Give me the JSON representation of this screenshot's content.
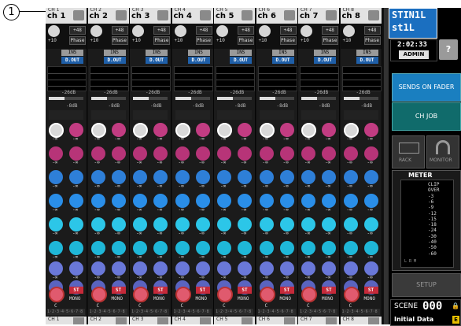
{
  "callout": {
    "label": "1"
  },
  "channels": [
    {
      "num": "CH 1",
      "name": "ch 1"
    },
    {
      "num": "CH 2",
      "name": "ch 2"
    },
    {
      "num": "CH 3",
      "name": "ch 3"
    },
    {
      "num": "CH 4",
      "name": "ch 4"
    },
    {
      "num": "CH 5",
      "name": "ch 5"
    },
    {
      "num": "CH 6",
      "name": "ch 6"
    },
    {
      "num": "CH 7",
      "name": "ch 7"
    },
    {
      "num": "CH 8",
      "name": "ch 8"
    }
  ],
  "strip": {
    "gain": "+10",
    "phantom": "+48",
    "phase": "Phase",
    "ins": "INS",
    "dout": "D.OUT",
    "thr1": "-26dB",
    "thr2": "-8dB",
    "send_value": "-∞",
    "pan_center": "C",
    "st": "ST",
    "mono": "MONO",
    "bus": "1·2·3·4·5·6·7·8"
  },
  "colors": {
    "send_row_1": "#c23c82",
    "send_row_2": "#b73478",
    "send_row_3": "#2e7fd8",
    "send_row_4": "#2a8ee8",
    "send_row_5": "#2cc6e8",
    "send_row_6": "#1fb7d8",
    "send_row_7": "#6a78d8",
    "send_row_8": "#5a64c0",
    "first_knob_big": "#d8d8d8"
  },
  "selected_channel": {
    "line1": "STIN1L",
    "line2": "st1L"
  },
  "clock": {
    "time": "2:02:33",
    "user": "ADMIN"
  },
  "help": {
    "label": "?"
  },
  "buttons": {
    "sends_on_fader": "SENDS ON FADER",
    "ch_job": "CH JOB",
    "rack": "RACK",
    "monitor": "MONITOR",
    "setup": "SETUP"
  },
  "meter": {
    "title": "METER",
    "scale": [
      "CLIP",
      "OVER",
      "-3",
      "-6",
      "-9",
      "-12",
      "-15",
      "-18",
      "-24",
      "-30",
      "-40",
      "-50",
      "-60"
    ],
    "lrm": "L  R  M"
  },
  "scene": {
    "label": "SCENE",
    "number": "000",
    "title": "Initial Data",
    "lock": "🔒",
    "edit": "E"
  }
}
